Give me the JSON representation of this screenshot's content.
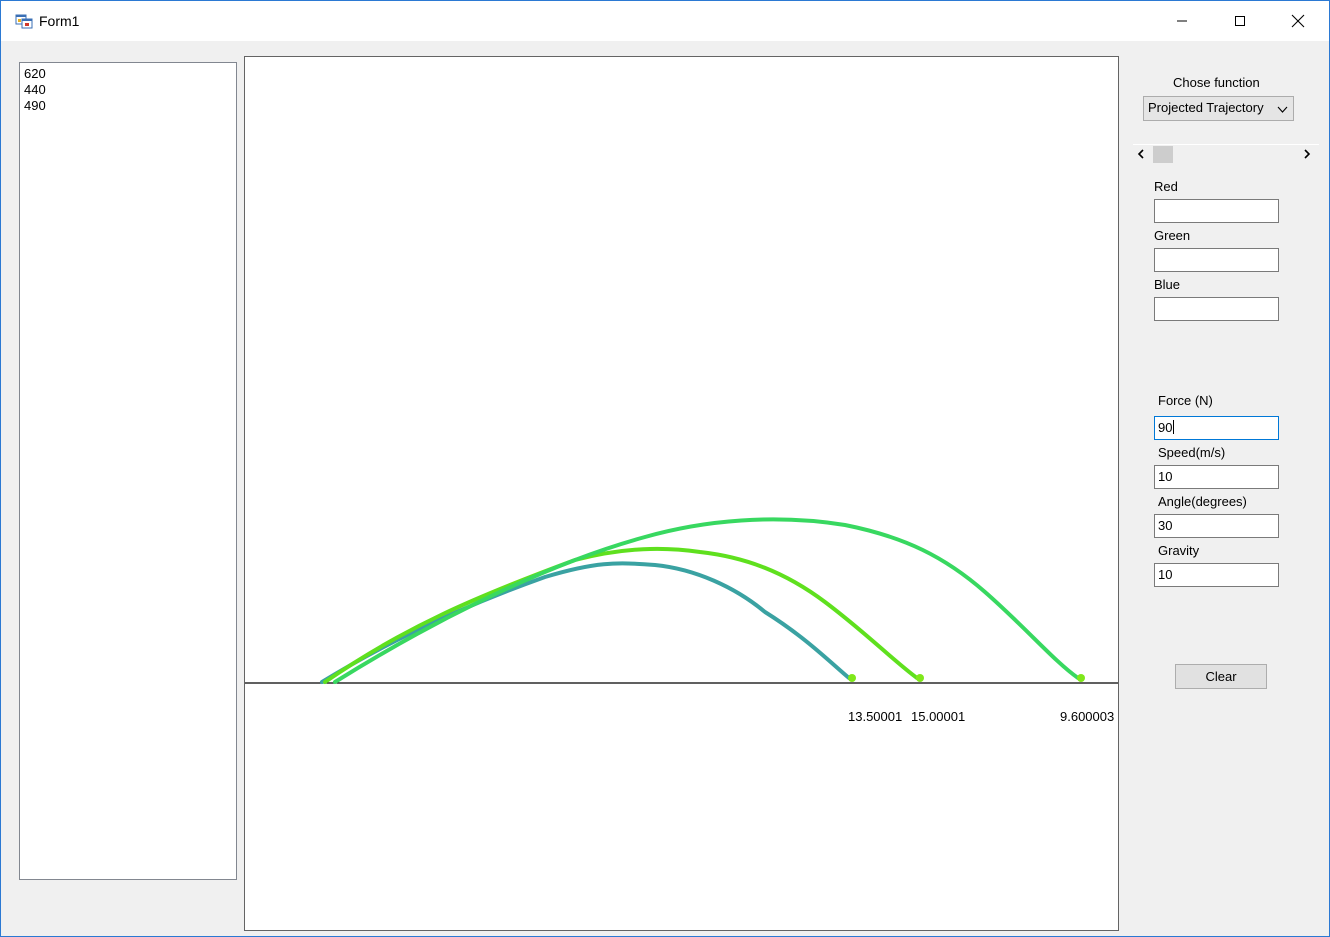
{
  "window": {
    "title": "Form1",
    "minimize_icon": "minimize-icon",
    "maximize_icon": "maximize-icon",
    "close_icon": "close-icon"
  },
  "results_list": {
    "items": [
      "620",
      "440",
      "490"
    ]
  },
  "canvas": {
    "landing_labels": [
      "13.50001",
      "15.00001",
      "9.600003"
    ],
    "trajectory_colors": [
      "#3aa2a2",
      "#5fe01e",
      "#38d860"
    ],
    "ground_line_color": "#000000"
  },
  "controls": {
    "function_label": "Chose function",
    "function_selected": "Projected Trajectory",
    "red_label": "Red",
    "red_value": "",
    "green_label": "Green",
    "green_value": "",
    "blue_label": "Blue",
    "blue_value": "",
    "force_label": "Force (N)",
    "force_value": "90",
    "speed_label": "Speed(m/s)",
    "speed_value": "10",
    "angle_label": "Angle(degrees)",
    "angle_value": "30",
    "gravity_label": "Gravity",
    "gravity_value": "10",
    "clear_label": "Clear"
  }
}
